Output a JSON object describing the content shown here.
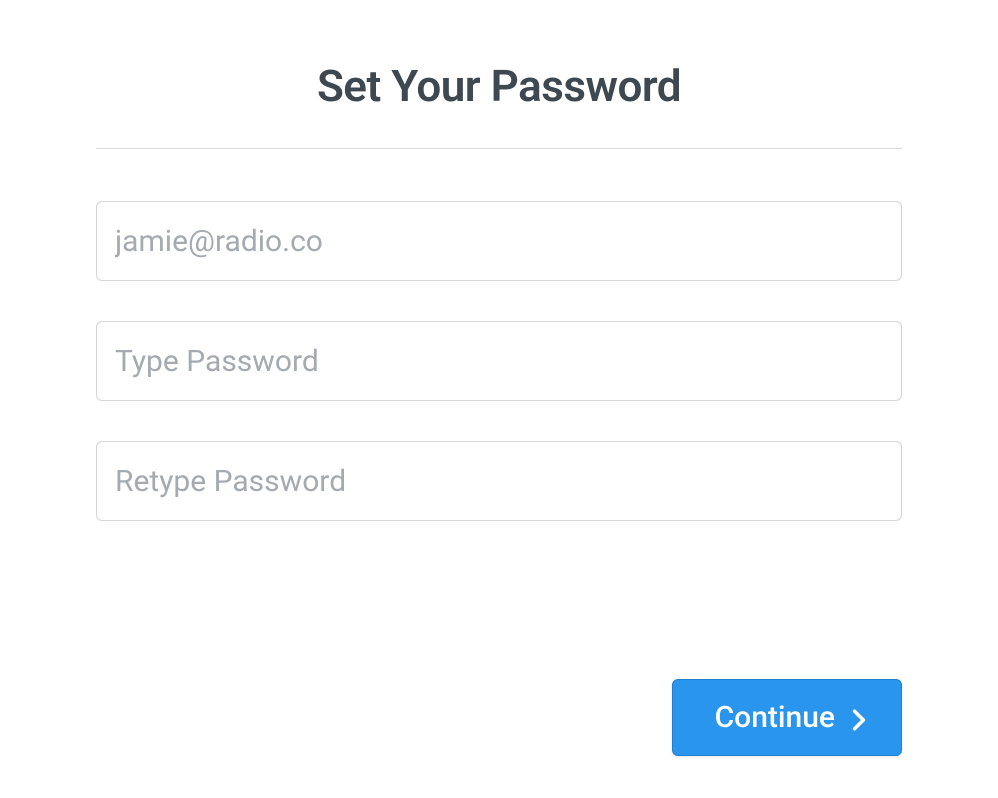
{
  "heading": "Set Your Password",
  "form": {
    "email": {
      "value": "jamie@radio.co"
    },
    "password": {
      "placeholder": "Type Password"
    },
    "password_confirm": {
      "placeholder": "Retype Password"
    }
  },
  "actions": {
    "continue_label": "Continue"
  }
}
